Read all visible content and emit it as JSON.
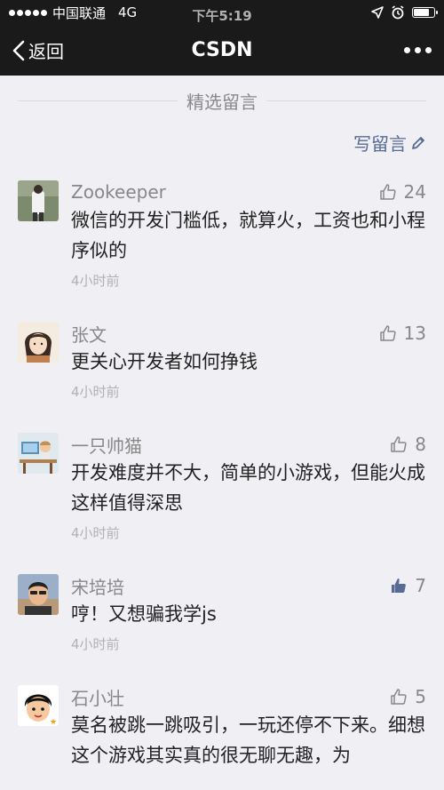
{
  "status": {
    "carrier": "中国联通",
    "network": "4G",
    "time": "下午5:19"
  },
  "nav": {
    "back_label": "返回",
    "title": "CSDN"
  },
  "section": {
    "title": "精选留言",
    "write_label": "写留言"
  },
  "colors": {
    "link": "#576b95",
    "nav_bg": "#1a1a1a",
    "page_bg": "#efeff4"
  },
  "comments": [
    {
      "nick": "Zookeeper",
      "likes": "24",
      "text": "微信的开发门槛低，就算火，工资也和小程序似的",
      "time": "4小时前"
    },
    {
      "nick": "张文",
      "likes": "13",
      "text": "更关心开发者如何挣钱",
      "time": "4小时前"
    },
    {
      "nick": "一只帅猫",
      "likes": "8",
      "text": "开发难度并不大，简单的小游戏，但能火成这样值得深思",
      "time": "4小时前"
    },
    {
      "nick": "宋培培",
      "likes": "7",
      "text": "哼！又想骗我学js",
      "time": "4小时前"
    },
    {
      "nick": "石小壮",
      "likes": "5",
      "text": "莫名被跳一跳吸引，一玩还停不下来。细想这个游戏其实真的很无聊无趣，为",
      "time": ""
    }
  ]
}
